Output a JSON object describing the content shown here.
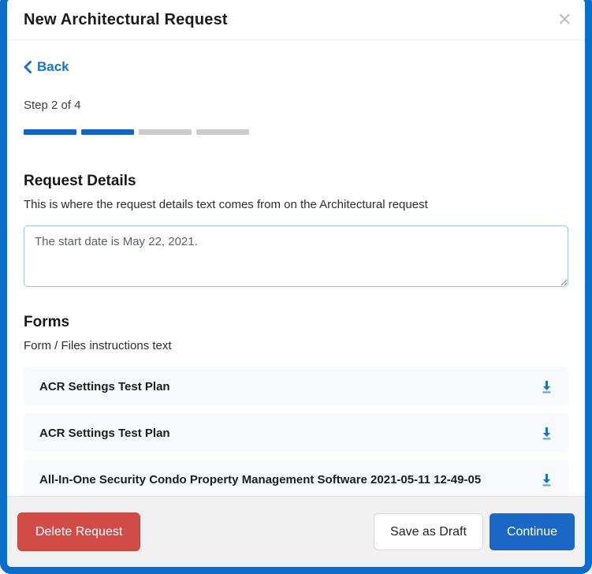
{
  "modal": {
    "title": "New Architectural Request",
    "close_glyph": "×"
  },
  "nav": {
    "back_label": "Back"
  },
  "progress": {
    "step_text": "Step 2 of 4",
    "total_segments": 4,
    "completed_segments": 2
  },
  "request_details": {
    "heading": "Request Details",
    "description": "This is where the request details text comes from on the Architectural request",
    "textarea_value": "The start date is May 22, 2021."
  },
  "forms": {
    "heading": "Forms",
    "instructions": "Form / Files instructions text",
    "files": [
      {
        "name": "ACR Settings Test Plan"
      },
      {
        "name": "ACR Settings Test Plan"
      },
      {
        "name": "All-In-One Security Condo Property Management Software 2021-05-11 12-49-05"
      }
    ]
  },
  "footer": {
    "delete_label": "Delete Request",
    "save_draft_label": "Save as Draft",
    "continue_label": "Continue"
  },
  "colors": {
    "frame_blue": "#0b6dca",
    "link_blue": "#1173d4",
    "progress_blue": "#1565c0",
    "progress_gray": "#cbcbcb",
    "danger_red": "#d14b47",
    "continue_blue": "#1b67c5",
    "download_icon_blue": "#1a74c4",
    "download_bar_blue": "#5ba3d4"
  }
}
